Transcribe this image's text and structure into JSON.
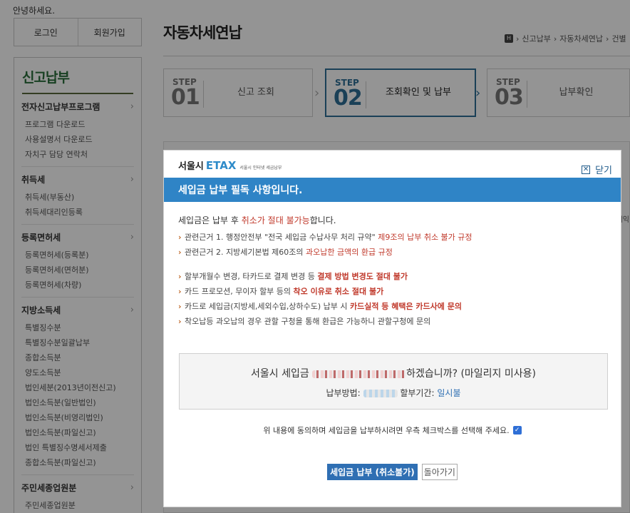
{
  "greeting": "안녕하세요.",
  "auth": {
    "login": "로그인",
    "signup": "회원가입"
  },
  "sidebar": {
    "title": "신고납부",
    "groups": [
      {
        "label": "전자신고납부프로그램",
        "items": [
          "프로그램 다운로드",
          "사용설명서 다운로드",
          "자치구 담당 연락처"
        ]
      },
      {
        "label": "취득세",
        "items": [
          "취득세(부동산)",
          "취득세대리인등록"
        ]
      },
      {
        "label": "등록면허세",
        "items": [
          "등록면허세(등록분)",
          "등록면허세(면허분)",
          "등록면허세(차량)"
        ]
      },
      {
        "label": "지방소득세",
        "items": [
          "특별징수분",
          "특별징수분일괄납부",
          "종합소득분",
          "양도소득분",
          "법인세분(2013년이전신고)",
          "법인소득분(일반법인)",
          "법인소득분(비영리법인)",
          "법인소득분(파일신고)",
          "법인 특별징수명세서제출",
          "종합소득분(파일신고)"
        ]
      },
      {
        "label": "주민세종업원분",
        "items": [
          "주민세종업원분"
        ]
      }
    ]
  },
  "page": {
    "title": "자동차세연납",
    "breadcrumb": [
      "신고납부",
      "자동차세연납",
      "건별"
    ]
  },
  "steps": [
    {
      "label": "STEP",
      "num": "01",
      "text": "신고 조회",
      "active": false
    },
    {
      "label": "STEP",
      "num": "02",
      "text": "조회확인 및 납부",
      "active": true
    },
    {
      "label": "STEP",
      "num": "03",
      "text": "납부확인",
      "active": false
    }
  ],
  "background_cut_text": "세익",
  "modal": {
    "logo_main": "서울시",
    "logo_etax": "ETAX",
    "logo_sub": "서울시 인터넷 세금납부",
    "close_label": "닫기",
    "banner": "세입금 납부 필독 사항입니다.",
    "intro_a": "세입금은 납부 후 ",
    "intro_b": "취소가 절대 불가능",
    "intro_c": "합니다.",
    "group1": [
      {
        "a": "관련근거 1. 행정안전부 \"전국 세입금 수납사무 처리 규약\" ",
        "b": "제9조의 납부 취소 불가 규정",
        "c": "",
        "style": "red"
      },
      {
        "a": "관련근거 2. 지방세기본법 제60조의 ",
        "b": "과오납한 금액의 환급 규정",
        "c": "",
        "style": "red"
      }
    ],
    "group2": [
      {
        "a": "할부개월수 변경, 타카드로 결제 변경 등 ",
        "b": "결제 방법 변경도 절대 불가",
        "c": "",
        "style": "red-b"
      },
      {
        "a": "카드 프로모션, 무이자 할부 등의 ",
        "b": "착오 이유로 취소 절대 불가",
        "c": "",
        "style": "red-b"
      },
      {
        "a": "카드로 세입금(지방세,세외수입,상하수도) 납부 시 ",
        "b": "카드실적 등 혜택은 카드사에 문의",
        "c": "",
        "style": "red-b"
      },
      {
        "a": "착오납등 과오납의 경우 관할 구청을 통해 환급은 가능하니 관할구청에 문의",
        "b": "",
        "c": "",
        "style": "red"
      }
    ],
    "confirm_prefix": "서울시 세입금",
    "confirm_suffix": "하겠습니까? (마일리지 미사용)",
    "method_label": "납부방법:",
    "period_label": "할부기간:",
    "period_value": "일시불",
    "agree_text": "위 내용에 동의하며 세입금을 납부하시려면 우측 체크박스를 선택해 주세요.",
    "agree_checked": true,
    "pay_button": "세입금 납부 (취소불가)",
    "back_button": "돌아가기"
  }
}
